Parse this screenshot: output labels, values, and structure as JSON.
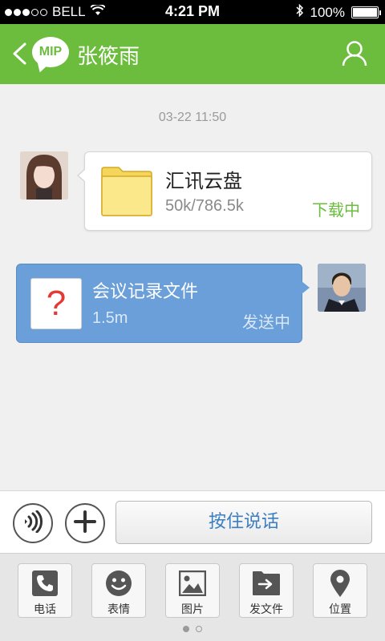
{
  "status_bar": {
    "carrier": "BELL",
    "time": "4:21 PM",
    "battery": "100%"
  },
  "nav": {
    "logo_text": "MIP",
    "contact_name": "张筱雨"
  },
  "timestamp": "03-22  11:50",
  "messages": [
    {
      "file_name": "汇讯云盘",
      "file_size": "50k/786.5k",
      "status": "下载中"
    },
    {
      "file_icon": "?",
      "file_name": "会议记录文件",
      "file_size": "1.5m",
      "status": "发送中"
    }
  ],
  "input_bar": {
    "hold_to_talk": "按住说话"
  },
  "toolbar": [
    {
      "label": "电话",
      "icon": "phone-icon"
    },
    {
      "label": "表情",
      "icon": "emoji-icon"
    },
    {
      "label": "图片",
      "icon": "image-icon"
    },
    {
      "label": "发文件",
      "icon": "send-file-icon"
    },
    {
      "label": "位置",
      "icon": "location-icon"
    }
  ],
  "colors": {
    "accent": "#6cbd3e",
    "outgoing_bubble": "#6a9fd9"
  }
}
